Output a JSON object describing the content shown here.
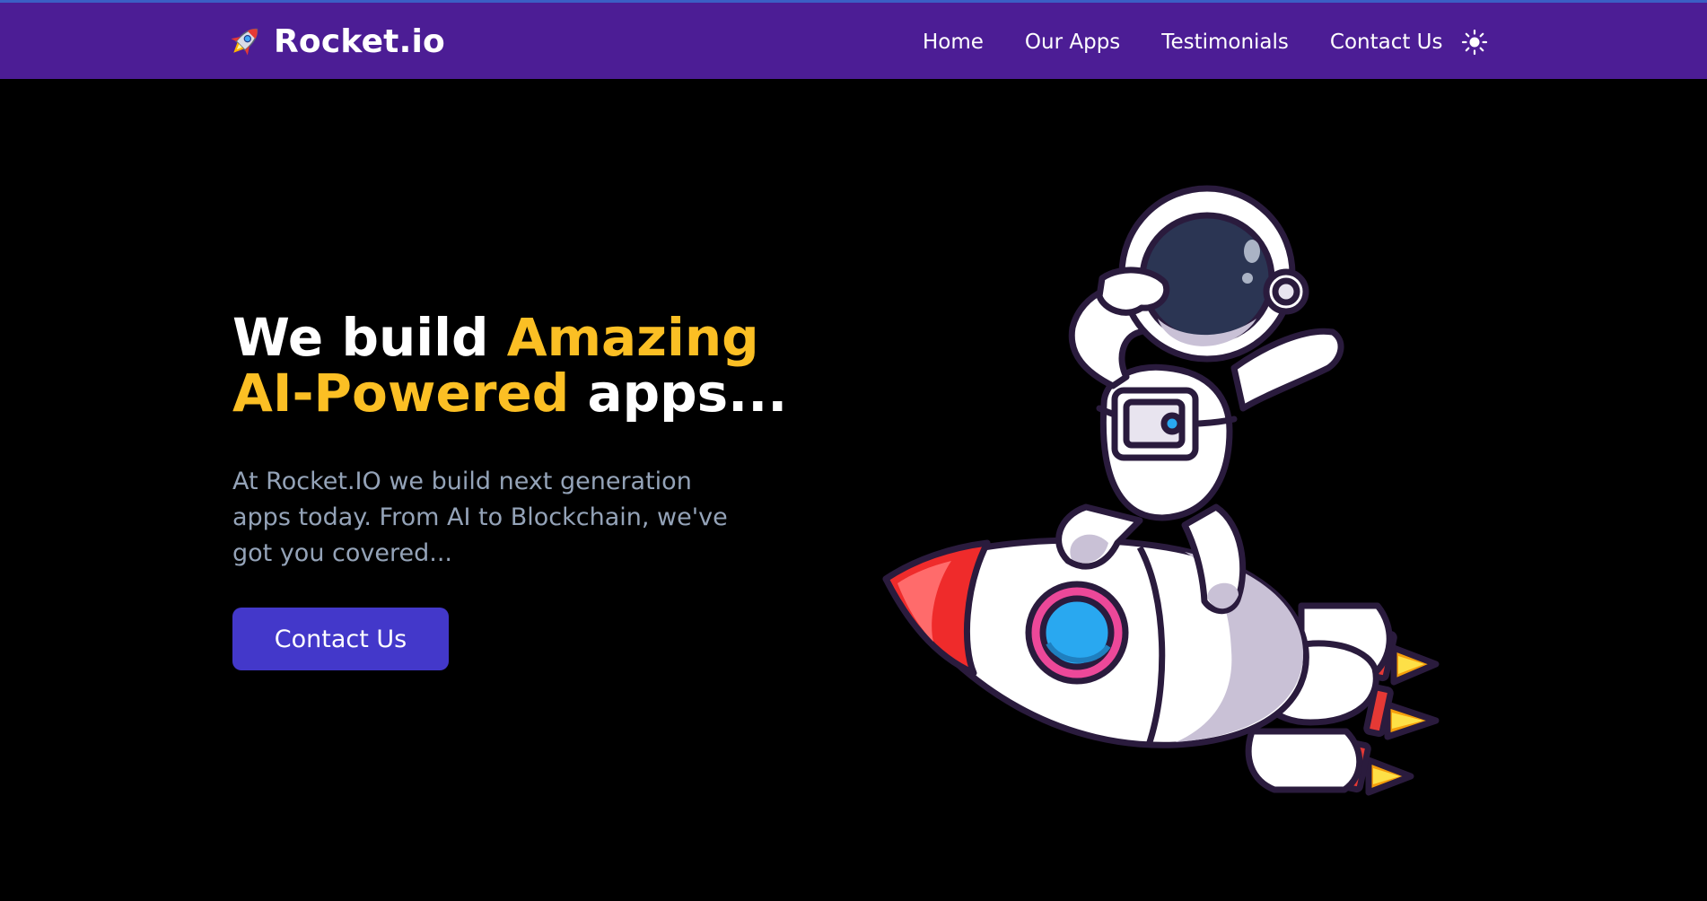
{
  "brand": {
    "name": "Rocket.io",
    "icon": "rocket-icon"
  },
  "nav": {
    "links": [
      "Home",
      "Our Apps",
      "Testimonials",
      "Contact Us"
    ],
    "theme_icon": "sun-icon"
  },
  "hero": {
    "headline_part1": "We build ",
    "headline_accent1": "Amazing",
    "headline_accent2": "AI-Powered",
    "headline_part2": " apps...",
    "subtext": "At Rocket.IO we build next generation apps today. From AI to Blockchain, we've got you covered...",
    "cta_label": "Contact Us",
    "illustration": "astronaut-on-rocket"
  },
  "colors": {
    "navbar": "#4c1d95",
    "background": "#000000",
    "accent": "#fbbf24",
    "button": "#4338ca",
    "subtext": "#94a3b8"
  }
}
